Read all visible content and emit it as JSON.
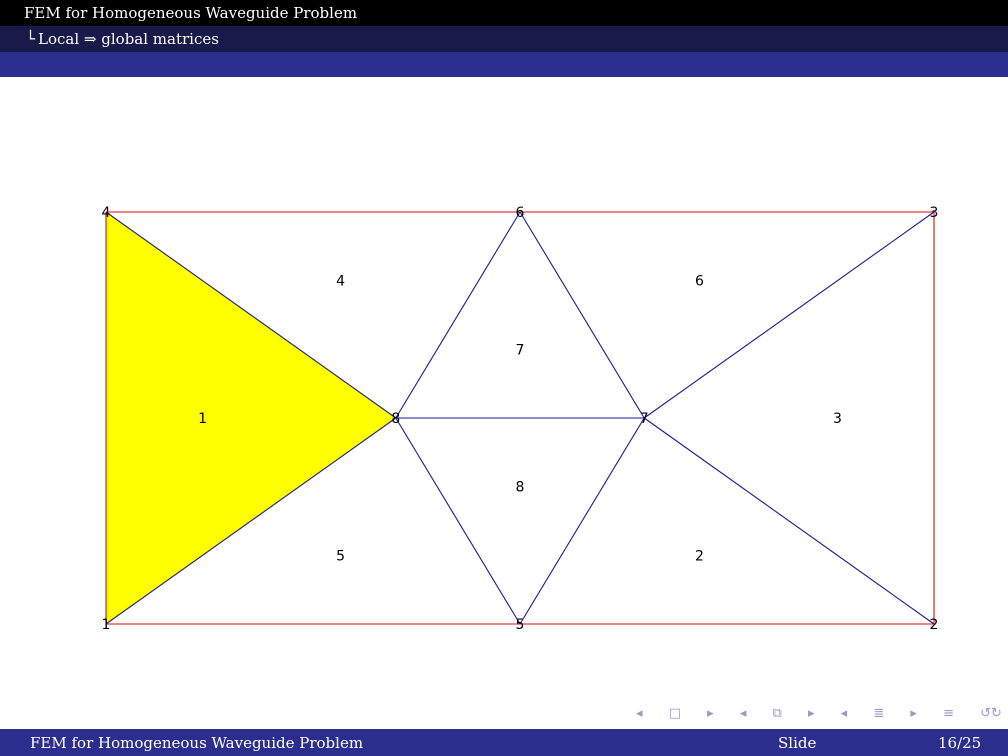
{
  "header": {
    "title": "FEM for Homogeneous Waveguide Problem",
    "subsection_corner": "└",
    "subsection": "Local ⇒ global matrices"
  },
  "mesh": {
    "nodes": [
      {
        "id": "1",
        "x": 0,
        "y": 0
      },
      {
        "id": "2",
        "x": 8,
        "y": 0
      },
      {
        "id": "3",
        "x": 8,
        "y": 4
      },
      {
        "id": "4",
        "x": 0,
        "y": 4
      },
      {
        "id": "5",
        "x": 4,
        "y": 0
      },
      {
        "id": "6",
        "x": 4,
        "y": 4
      },
      {
        "id": "7",
        "x": 5.2,
        "y": 2
      },
      {
        "id": "8",
        "x": 2.8,
        "y": 2
      }
    ],
    "elements": [
      {
        "id": "1",
        "nodes": [
          "1",
          "8",
          "4"
        ],
        "highlight": true
      },
      {
        "id": "2",
        "nodes": [
          "5",
          "2",
          "7"
        ],
        "highlight": false
      },
      {
        "id": "3",
        "nodes": [
          "2",
          "3",
          "7"
        ],
        "highlight": false
      },
      {
        "id": "4",
        "nodes": [
          "4",
          "8",
          "6"
        ],
        "highlight": false
      },
      {
        "id": "5",
        "nodes": [
          "1",
          "5",
          "8"
        ],
        "highlight": false
      },
      {
        "id": "6",
        "nodes": [
          "7",
          "3",
          "6"
        ],
        "highlight": false
      },
      {
        "id": "7",
        "nodes": [
          "8",
          "7",
          "6"
        ],
        "highlight": false
      },
      {
        "id": "8",
        "nodes": [
          "8",
          "5",
          "7"
        ],
        "highlight": false
      }
    ],
    "colors": {
      "boundary": "#cc1111",
      "interior": "#1a1a99",
      "highlight": "#ffff00"
    }
  },
  "nav": {
    "icons": [
      "nav-left-arrow",
      "frame-icon",
      "nav-right-arrow",
      "subsection-icon",
      "section-icon",
      "toc-icon",
      "search-icon"
    ],
    "prev": "◂",
    "frame": "□",
    "next": "▸",
    "subsec": "⧉",
    "sec": "≣",
    "align": "≡",
    "search": "↺↻"
  },
  "footer": {
    "title": "FEM for Homogeneous Waveguide Problem",
    "label": "Slide",
    "page": "16/25"
  }
}
